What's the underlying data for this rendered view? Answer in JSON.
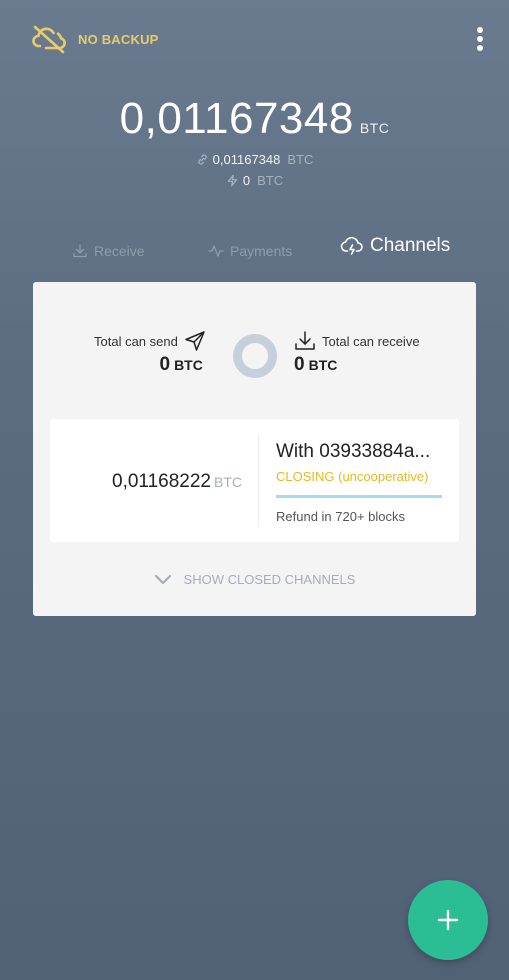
{
  "header": {
    "backup_label": "NO BACKUP",
    "backup_icon": "cloud-off-icon",
    "menu_icon": "more-vertical-icon"
  },
  "balance": {
    "total": "0,01167348",
    "total_unit": "BTC",
    "onchain": "0,01167348",
    "onchain_unit": "BTC",
    "lightning": "0",
    "lightning_unit": "BTC"
  },
  "tabs": [
    {
      "label": "Receive",
      "icon": "download-icon",
      "active": false
    },
    {
      "label": "Payments",
      "icon": "activity-icon",
      "active": false
    },
    {
      "label": "Channels",
      "icon": "cloud-lightning-icon",
      "active": true
    }
  ],
  "summary": {
    "send_label": "Total can send",
    "send_value": "0",
    "send_unit": "BTC",
    "receive_label": "Total can receive",
    "receive_value": "0",
    "receive_unit": "BTC"
  },
  "channel": {
    "amount": "0,01168222",
    "amount_unit": "BTC",
    "peer": "With 03933884a...",
    "state": "CLOSING (uncooperative)",
    "refund": "Refund in 720+ blocks"
  },
  "show_closed_label": "SHOW CLOSED CHANNELS",
  "colors": {
    "accent": "#2bbd93",
    "warning": "#e7b91e",
    "backup": "#e9cc6a",
    "progress": "#a9d9ee"
  }
}
